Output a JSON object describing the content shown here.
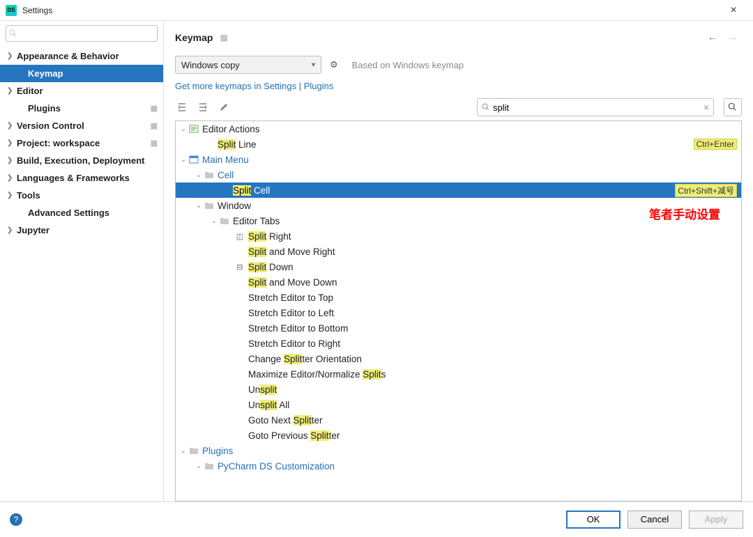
{
  "window": {
    "title": "Settings",
    "close": "×"
  },
  "sidebar": {
    "search_placeholder": "",
    "items": [
      {
        "label": "Appearance & Behavior",
        "exp": true,
        "sub": false
      },
      {
        "label": "Keymap",
        "exp": false,
        "sub": true,
        "selected": true
      },
      {
        "label": "Editor",
        "exp": true,
        "sub": false
      },
      {
        "label": "Plugins",
        "exp": false,
        "sub": true,
        "gear": true
      },
      {
        "label": "Version Control",
        "exp": true,
        "sub": false,
        "gear": true
      },
      {
        "label": "Project: workspace",
        "exp": true,
        "sub": false,
        "gear": true
      },
      {
        "label": "Build, Execution, Deployment",
        "exp": true,
        "sub": false
      },
      {
        "label": "Languages & Frameworks",
        "exp": true,
        "sub": false
      },
      {
        "label": "Tools",
        "exp": true,
        "sub": false
      },
      {
        "label": "Advanced Settings",
        "exp": false,
        "sub": true
      },
      {
        "label": "Jupyter",
        "exp": true,
        "sub": false
      }
    ]
  },
  "header": {
    "breadcrumb": "Keymap",
    "back_enabled": true,
    "fwd_enabled": false
  },
  "toolbar": {
    "keymap_name": "Windows copy",
    "based_on": "Based on Windows keymap",
    "link_text": "Get more keymaps in Settings | Plugins",
    "filter_value": "split"
  },
  "tree": {
    "rows": [
      {
        "depth": 0,
        "exp": "open",
        "icon": "editor",
        "label": "Editor Actions",
        "link": false
      },
      {
        "depth": 1,
        "exp": "none",
        "icon": "",
        "pre": "",
        "hl": "Split",
        "post": " Line",
        "shortcut": "Ctrl+Enter"
      },
      {
        "depth": 0,
        "exp": "open",
        "icon": "menu",
        "label": "Main Menu",
        "link": true
      },
      {
        "depth": 1,
        "exp": "open",
        "icon": "folder",
        "label": "Cell",
        "link": true
      },
      {
        "depth": 2,
        "exp": "none",
        "icon": "",
        "pre": "",
        "hl": "Split",
        "post": " Cell",
        "shortcut": "Ctrl+Shift+减号",
        "selected": true
      },
      {
        "depth": 1,
        "exp": "open",
        "icon": "folder",
        "label": "Window",
        "link": false
      },
      {
        "depth": 2,
        "exp": "open",
        "icon": "folder",
        "label": "Editor Tabs",
        "link": false
      },
      {
        "depth": 3,
        "exp": "none",
        "icon": "split-v",
        "pre": "",
        "hl": "Split",
        "post": " Right"
      },
      {
        "depth": 3,
        "exp": "none",
        "icon": "",
        "pre": "",
        "hl": "Split",
        "post": " and Move Right"
      },
      {
        "depth": 3,
        "exp": "none",
        "icon": "split-h",
        "pre": "",
        "hl": "Split",
        "post": " Down"
      },
      {
        "depth": 3,
        "exp": "none",
        "icon": "",
        "pre": "",
        "hl": "Split",
        "post": " and Move Down"
      },
      {
        "depth": 3,
        "exp": "none",
        "icon": "",
        "label": "Stretch Editor to Top"
      },
      {
        "depth": 3,
        "exp": "none",
        "icon": "",
        "label": "Stretch Editor to Left"
      },
      {
        "depth": 3,
        "exp": "none",
        "icon": "",
        "label": "Stretch Editor to Bottom"
      },
      {
        "depth": 3,
        "exp": "none",
        "icon": "",
        "label": "Stretch Editor to Right"
      },
      {
        "depth": 3,
        "exp": "none",
        "icon": "",
        "pre": "Change ",
        "hl": "Split",
        "post": "ter Orientation"
      },
      {
        "depth": 3,
        "exp": "none",
        "icon": "",
        "pre": "Maximize Editor/Normalize ",
        "hl": "Split",
        "post": "s"
      },
      {
        "depth": 3,
        "exp": "none",
        "icon": "",
        "pre": "Un",
        "hl": "split",
        "post": ""
      },
      {
        "depth": 3,
        "exp": "none",
        "icon": "",
        "pre": "Un",
        "hl": "split",
        "post": " All"
      },
      {
        "depth": 3,
        "exp": "none",
        "icon": "",
        "pre": "Goto Next ",
        "hl": "Split",
        "post": "ter"
      },
      {
        "depth": 3,
        "exp": "none",
        "icon": "",
        "pre": "Goto Previous ",
        "hl": "Split",
        "post": "ter"
      },
      {
        "depth": 0,
        "exp": "open",
        "icon": "folder",
        "label": "Plugins",
        "link": true
      },
      {
        "depth": 1,
        "exp": "open",
        "icon": "folder",
        "label": "PyCharm DS Customization",
        "link": true
      }
    ]
  },
  "annotation": "笔者手动设置",
  "footer": {
    "ok": "OK",
    "cancel": "Cancel",
    "apply": "Apply"
  }
}
